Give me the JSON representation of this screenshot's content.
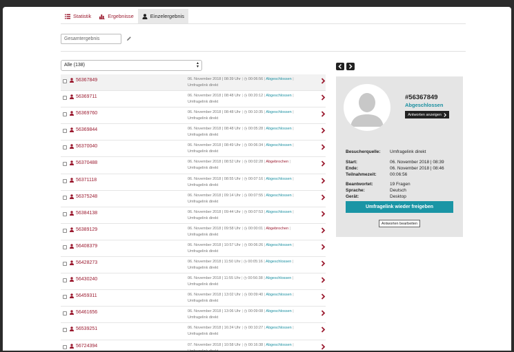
{
  "tabs": [
    {
      "label": "Statistik",
      "icon": "list-icon",
      "active": false
    },
    {
      "label": "Ergebnisse",
      "icon": "bar-chart-icon",
      "active": false
    },
    {
      "label": "Einzelergebnis",
      "icon": "user-icon",
      "active": true
    }
  ],
  "filter": {
    "value": "Gesamtergebnis"
  },
  "select": {
    "value": "Alle (138)"
  },
  "colors": {
    "accent": "#9b1b30",
    "teal": "#1a8fa0",
    "button_teal": "#1a95a5"
  },
  "rows": [
    {
      "id": "56367849",
      "date": "06. November 2018 | 08:39 Uhr",
      "duration": "00:06:56",
      "status": "Abgeschlossen",
      "source": "Umfragelink direkt"
    },
    {
      "id": "56369711",
      "date": "06. November 2018 | 08:48 Uhr",
      "duration": "00:20:12",
      "status": "Abgeschlossen",
      "source": "Umfragelink direkt"
    },
    {
      "id": "56369760",
      "date": "06. November 2018 | 08:48 Uhr",
      "duration": "00:10:35",
      "status": "Abgeschlossen",
      "source": "Umfragelink direkt"
    },
    {
      "id": "56369844",
      "date": "06. November 2018 | 08:48 Uhr",
      "duration": "00:05:28",
      "status": "Abgeschlossen",
      "source": "Umfragelink direkt"
    },
    {
      "id": "56370040",
      "date": "06. November 2018 | 08:49 Uhr",
      "duration": "00:06:34",
      "status": "Abgeschlossen",
      "source": "Umfragelink direkt"
    },
    {
      "id": "56370488",
      "date": "06. November 2018 | 08:52 Uhr",
      "duration": "00:02:28",
      "status": "Abgebrochen",
      "source": "Umfragelink direkt"
    },
    {
      "id": "56371118",
      "date": "06. November 2018 | 08:55 Uhr",
      "duration": "00:07:16",
      "status": "Abgeschlossen",
      "source": "Umfragelink direkt"
    },
    {
      "id": "56375248",
      "date": "06. November 2018 | 09:14 Uhr",
      "duration": "00:07:55",
      "status": "Abgeschlossen",
      "source": "Umfragelink direkt"
    },
    {
      "id": "56384138",
      "date": "06. November 2018 | 09:44 Uhr",
      "duration": "00:07:53",
      "status": "Abgeschlossen",
      "source": "Umfragelink direkt"
    },
    {
      "id": "56389129",
      "date": "06. November 2018 | 09:58 Uhr",
      "duration": "00:00:01",
      "status": "Abgebrochen",
      "source": "Umfragelink direkt"
    },
    {
      "id": "56408379",
      "date": "06. November 2018 | 10:57 Uhr",
      "duration": "00:06:26",
      "status": "Abgeschlossen",
      "source": "Umfragelink direkt"
    },
    {
      "id": "56428273",
      "date": "06. November 2018 | 11:50 Uhr",
      "duration": "00:05:16",
      "status": "Abgeschlossen",
      "source": "Umfragelink direkt"
    },
    {
      "id": "56430240",
      "date": "06. November 2018 | 11:55 Uhr",
      "duration": "00:56:38",
      "status": "Abgeschlossen",
      "source": "Umfragelink direkt"
    },
    {
      "id": "56459311",
      "date": "06. November 2018 | 13:02 Uhr",
      "duration": "00:09:40",
      "status": "Abgeschlossen",
      "source": "Umfragelink direkt"
    },
    {
      "id": "56461656",
      "date": "06. November 2018 | 13:06 Uhr",
      "duration": "00:09:08",
      "status": "Abgeschlossen",
      "source": "Umfragelink direkt"
    },
    {
      "id": "56539251",
      "date": "06. November 2018 | 16:24 Uhr",
      "duration": "00:10:27",
      "status": "Abgeschlossen",
      "source": "Umfragelink direkt"
    },
    {
      "id": "56724394",
      "date": "07. November 2018 | 10:58 Uhr",
      "duration": "00:16:38",
      "status": "Abgeschlossen",
      "source": "Umfragelink direkt"
    }
  ],
  "detail": {
    "id": "#56367849",
    "status": "Abgeschlossen",
    "show_answers_label": "Antworten anzeigen",
    "source_label": "Besucherquelle:",
    "source_value": "Umfragelink direkt",
    "start_label": "Start:",
    "start_value": "06. November 2018 | 08:39",
    "end_label": "Ende:",
    "end_value": "06. November 2018 | 08:46",
    "duration_label": "Teilnahmezeit:",
    "duration_value": "00:06:56",
    "answered_label": "Beantwortet:",
    "answered_value": "19 Fragen",
    "language_label": "Sprache:",
    "language_value": "Deutsch",
    "device_label": "Gerät:",
    "device_value": "Desktop",
    "release_button": "Umfragelink wieder freigeben",
    "edit_button": "Antworten bearbeiten"
  }
}
